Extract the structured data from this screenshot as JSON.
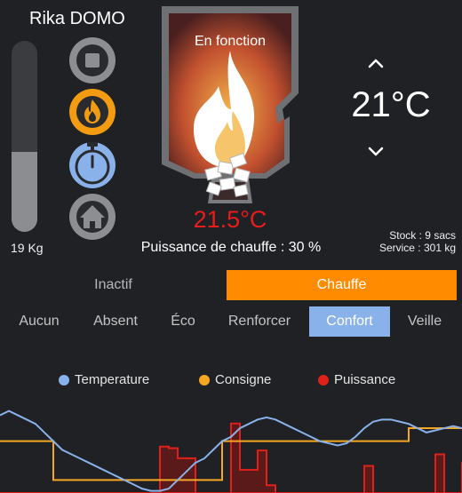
{
  "app": {
    "title": "Rika DOMO"
  },
  "pellets": {
    "label": "19 Kg",
    "level_fraction": 0.42
  },
  "stove": {
    "status": "En fonction",
    "current_temp": "21.5°C",
    "power_text": "Puissance de chauffe : 30 %"
  },
  "setpoint": {
    "value": "21°C"
  },
  "info": {
    "stock": "Stock : 9 sacs",
    "service": "Service : 301 kg"
  },
  "modes": {
    "inactive": "Inactif",
    "heating": "Chauffe",
    "selected": "Chauffe"
  },
  "presets": {
    "items": [
      "Aucun",
      "Absent",
      "Éco",
      "Renforcer",
      "Confort",
      "Veille"
    ],
    "selected": "Confort"
  },
  "colors": {
    "accent_orange": "#ff8c00",
    "accent_blue": "#8ab2ea",
    "temperature": "#8ab2ea",
    "setpoint": "#f5a623",
    "power": "#e0201a"
  },
  "icons": {
    "stop": "stop-icon",
    "flame": "flame-icon",
    "timer": "stopwatch-icon",
    "home": "home-icon",
    "up": "chevron-up-icon",
    "down": "chevron-down-icon"
  },
  "chart_data": {
    "type": "line",
    "legend": [
      "Temperature",
      "Consigne",
      "Puissance"
    ],
    "legend_position": "top",
    "x_count": 53,
    "series": [
      {
        "name": "Temperature",
        "values": [
          21.6,
          21.7,
          21.6,
          21.5,
          21.4,
          21.2,
          21.0,
          20.8,
          20.7,
          20.6,
          20.5,
          20.4,
          20.3,
          20.2,
          20.1,
          20.0,
          19.9,
          19.85,
          19.85,
          19.9,
          20.1,
          20.3,
          20.5,
          20.6,
          20.8,
          21.0,
          21.1,
          21.3,
          21.4,
          21.5,
          21.55,
          21.5,
          21.4,
          21.3,
          21.2,
          21.1,
          21.0,
          20.95,
          20.9,
          20.95,
          21.1,
          21.3,
          21.45,
          21.5,
          21.5,
          21.45,
          21.4,
          21.3,
          21.2,
          21.25,
          21.3,
          21.35,
          21.3
        ]
      },
      {
        "name": "Consigne",
        "values": [
          21.0,
          21.0,
          21.0,
          21.0,
          21.0,
          21.0,
          20.1,
          20.1,
          20.1,
          20.1,
          20.1,
          20.1,
          20.1,
          20.1,
          20.1,
          20.1,
          20.1,
          20.1,
          20.1,
          20.1,
          20.1,
          20.1,
          20.1,
          20.1,
          20.1,
          21.0,
          21.0,
          21.0,
          21.0,
          21.0,
          21.0,
          21.0,
          21.0,
          21.0,
          21.0,
          21.0,
          21.0,
          21.0,
          21.0,
          21.0,
          21.0,
          21.0,
          21.0,
          21.0,
          21.0,
          21.0,
          21.3,
          21.3,
          21.3,
          21.3,
          21.3,
          21.3,
          21.3
        ]
      },
      {
        "name": "Puissance",
        "values": [
          0,
          0,
          0,
          0,
          0,
          0,
          0,
          0,
          0,
          0,
          0,
          0,
          0,
          0,
          0,
          0,
          0,
          0,
          60,
          58,
          45,
          45,
          0,
          0,
          0,
          0,
          90,
          30,
          30,
          55,
          10,
          0,
          0,
          0,
          0,
          0,
          0,
          0,
          0,
          0,
          0,
          35,
          0,
          0,
          0,
          0,
          0,
          0,
          0,
          50,
          0,
          0,
          40
        ]
      }
    ],
    "ylim": [
      19.8,
      22.0
    ],
    "power_ylim": [
      0,
      100
    ]
  }
}
